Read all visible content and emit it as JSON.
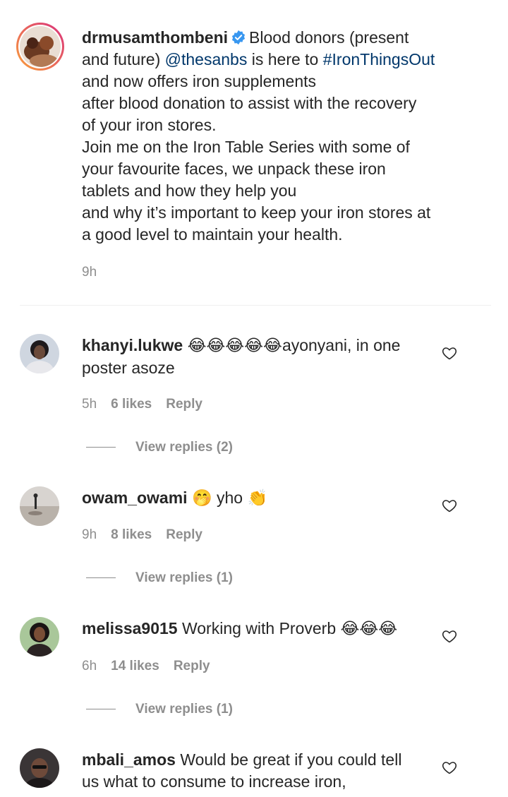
{
  "post": {
    "username": "drmusamthombeni",
    "caption_lines": [
      "Blood donors (present",
      "and future) ",
      "@thesanbs",
      " is here to ",
      "#IronThingsOut",
      "and now offers iron supplements",
      "after blood donation to assist with the recovery",
      "of your iron stores.",
      "Join me on the Iron Table Series with some of",
      "your favourite faces, we unpack these iron",
      "tablets and how they help you",
      "and why it’s important to keep your iron stores at",
      "a good level to maintain your health."
    ],
    "time": "9h",
    "verified_icon": "verified-badge-icon",
    "accent_colors": {
      "link": "#00376b",
      "verified": "#3897f0",
      "ring_start": "#f9a13b",
      "ring_end": "#d92f7c"
    }
  },
  "comments": [
    {
      "username": "khanyi.lukwe",
      "text_before": "",
      "emojis": "😂😂😂😂😂",
      "text_after": "ayonyani, in one",
      "text_line2": "poster asoze",
      "time": "5h",
      "likes": "6 likes",
      "reply": "Reply",
      "view_replies": "View replies (2)"
    },
    {
      "username": "owam_owami",
      "emoji1": "🤭",
      "text": " yho ",
      "emoji2": "👏",
      "time": "9h",
      "likes": "8 likes",
      "reply": "Reply",
      "view_replies": "View replies (1)"
    },
    {
      "username": "melissa9015",
      "text": "Working with Proverb ",
      "emojis": "😂😂😂",
      "time": "6h",
      "likes": "14 likes",
      "reply": "Reply",
      "view_replies": "View replies (1)"
    },
    {
      "username": "mbali_amos",
      "text": "Would be great if you could tell",
      "text_line2": "us what to consume to increase iron,"
    }
  ],
  "icons": {
    "like": "heart-outline-icon"
  }
}
